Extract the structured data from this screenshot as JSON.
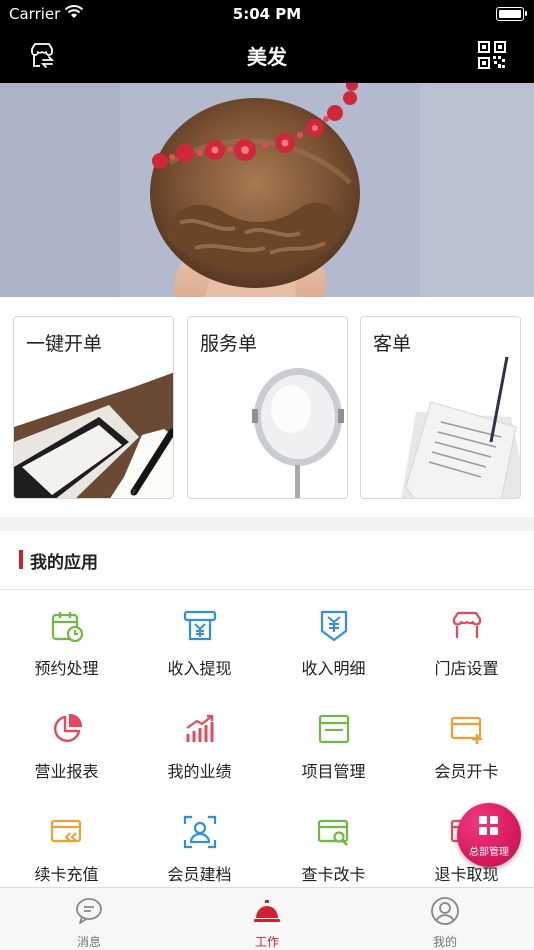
{
  "status_bar": {
    "carrier": "Carrier",
    "time": "5:04 PM"
  },
  "nav": {
    "title": "美发",
    "left_icon": "store-switch-icon",
    "right_icon": "qr-code-icon"
  },
  "quick_cards": [
    {
      "label": "一键开单",
      "icon": "notebook-pen-image"
    },
    {
      "label": "服务单",
      "icon": "mirror-image"
    },
    {
      "label": "客单",
      "icon": "receipt-spike-image"
    }
  ],
  "apps_section": {
    "title": "我的应用",
    "items": [
      {
        "label": "预约处理",
        "icon": "calendar-clock-icon",
        "color": "#6dbb3d"
      },
      {
        "label": "收入提现",
        "icon": "yuan-withdraw-icon",
        "color": "#2f8fe0"
      },
      {
        "label": "收入明细",
        "icon": "yuan-detail-icon",
        "color": "#2f8fe0"
      },
      {
        "label": "门店设置",
        "icon": "storefront-icon",
        "color": "#e8485b"
      },
      {
        "label": "营业报表",
        "icon": "pie-chart-icon",
        "color": "#e8485b"
      },
      {
        "label": "我的业绩",
        "icon": "bar-trend-icon",
        "color": "#e8485b"
      },
      {
        "label": "项目管理",
        "icon": "window-list-icon",
        "color": "#6dbb3d"
      },
      {
        "label": "会员开卡",
        "icon": "card-add-icon",
        "color": "#f0a030"
      },
      {
        "label": "续卡充值",
        "icon": "card-recharge-icon",
        "color": "#f0a030"
      },
      {
        "label": "会员建档",
        "icon": "member-scan-icon",
        "color": "#2f8fe0"
      },
      {
        "label": "查卡改卡",
        "icon": "card-search-icon",
        "color": "#6dbb3d"
      },
      {
        "label": "退卡取现",
        "icon": "card-refund-icon",
        "color": "#e8485b"
      }
    ]
  },
  "fab": {
    "label": "总部管理",
    "color": "#d81a5e"
  },
  "tabs": [
    {
      "label": "消息",
      "icon": "chat-icon",
      "active": false
    },
    {
      "label": "工作",
      "icon": "service-bell-icon",
      "active": true
    },
    {
      "label": "我的",
      "icon": "user-icon",
      "active": false
    }
  ],
  "accent_color": "#d4202c"
}
